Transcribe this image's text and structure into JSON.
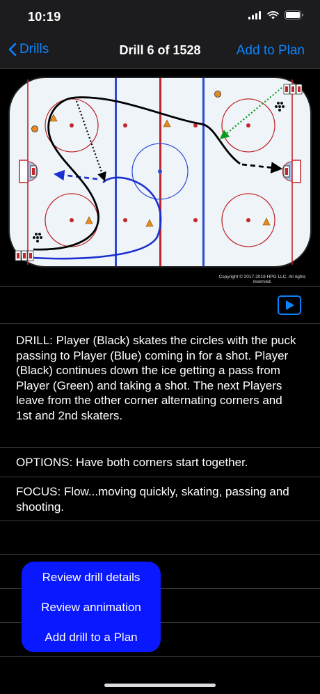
{
  "status_bar": {
    "time": "10:19"
  },
  "nav": {
    "back_label": "Drills",
    "title": "Drill 6 of 1528",
    "action_label": "Add to Plan"
  },
  "diagram": {
    "copyright": "Copyright © 2017-2019 HPG LLC. All rights reserved."
  },
  "content": {
    "drill": "DRILL: Player (Black) skates the circles with the puck passing to Player (Blue) coming in for a shot. Player (Black) continues down the ice getting a pass from Player (Green) and taking a shot. The next Players leave from the other corner alternating corners and 1st and 2nd skaters.",
    "options": "OPTIONS: Have both corners start together.",
    "focus": "FOCUS: Flow...moving quickly, skating, passing and shooting."
  },
  "menu": {
    "items": [
      "Review drill details",
      "Review annimation",
      "Add drill to a Plan"
    ]
  },
  "colors": {
    "accent": "#0a84ff",
    "menu_bg": "#0a18ff"
  }
}
